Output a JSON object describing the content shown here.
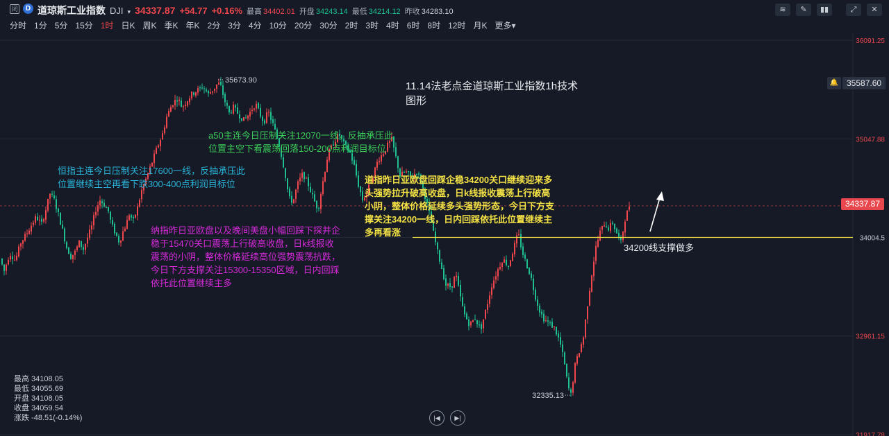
{
  "header": {
    "close_icon": "闭",
    "logo_icon": "D",
    "name": "道琼斯工业指数",
    "code": "DJI",
    "price": "34337.87",
    "change": "+54.77",
    "change_pct": "+0.16%",
    "high_label": "最高",
    "high_value": "34402.01",
    "open_label": "开盘",
    "open_value": "34243.14",
    "low_label": "最低",
    "low_value": "34214.12",
    "prev_label": "昨收",
    "prev_value": "34283.10"
  },
  "tools": [
    "trend-tool-icon",
    "draw-tool-icon",
    "indicator-tool-icon",
    "expand-icon",
    "close-icon"
  ],
  "periods": [
    "分时",
    "1分",
    "5分",
    "15分",
    "1时",
    "日K",
    "周K",
    "季K",
    "年K",
    "2分",
    "3分",
    "4分",
    "10分",
    "20分",
    "30分",
    "2时",
    "3时",
    "4时",
    "6时",
    "8时",
    "12时",
    "月K",
    "更多▾"
  ],
  "active_period": "1时",
  "ohlc_panel": {
    "high": "最高 34108.05",
    "low": "最低 34055.69",
    "open": "开盘 34108.05",
    "close": "收盘 34059.54",
    "change": "涨跌 -48.51(-0.14%)"
  },
  "alert": {
    "icon": "bell-icon",
    "value": "35587.60"
  },
  "current_price_tag": "34337.87",
  "support_line_value": "34004.5",
  "annotations": {
    "title": [
      "11.14法老点金道琼斯工业指数1h技术",
      "图形"
    ],
    "a50": [
      "a50主连今日压制关注12070一线，反抽承压此",
      "位置主空下看震荡回落150-200点利润目标位"
    ],
    "hsi": [
      "恒指主连今日压制关注17600一线，反抽承压此",
      "位置继续主空再看下跌300-400点利润目标位"
    ],
    "dji": [
      "道指昨日亚欧盘回踩企稳34200关口继续迎来多",
      "头强势拉升破高收盘，日k线报收震荡上行破高",
      "小阴，整体价格延续多头强势形态，今日下方支",
      "撑关注34200一线，日内回踩依托此位置继续主",
      "多再看涨"
    ],
    "ndx": [
      "纳指昨日亚欧盘以及晚间美盘小幅回踩下探并企",
      "稳于15470关口震荡上行破高收盘，日k线报收",
      "震荡的小阴，整体价格延续高位强势震荡抗跌，",
      "今日下方支撑关注15300-15350区域，日内回踩",
      "依托此位置继续主多"
    ],
    "support": "34200线支撑做多"
  },
  "chart_data": {
    "type": "candlestick",
    "title": "",
    "y_axis_ticks": [
      "36091.25",
      "35047.88",
      "34004.5",
      "32961.15",
      "31917.78"
    ],
    "ylim": [
      31917.78,
      36091.25
    ],
    "grid": true,
    "high_marker": "35673.90",
    "low_marker": "32335.13",
    "last_price": 34337.87,
    "horizontal_line": 34004.5,
    "colors": {
      "up": "#f0474c",
      "down": "#1fbf8f",
      "support": "#f2e045",
      "background": "#151a26"
    },
    "path": [
      [
        0,
        33780
      ],
      [
        6,
        33650
      ],
      [
        14,
        33840
      ],
      [
        22,
        33760
      ],
      [
        30,
        33950
      ],
      [
        38,
        34040
      ],
      [
        44,
        34120
      ],
      [
        52,
        34220
      ],
      [
        60,
        34150
      ],
      [
        66,
        34300
      ],
      [
        72,
        34470
      ],
      [
        78,
        34400
      ],
      [
        84,
        34250
      ],
      [
        90,
        34080
      ],
      [
        96,
        33900
      ],
      [
        102,
        33800
      ],
      [
        108,
        33850
      ],
      [
        114,
        33950
      ],
      [
        120,
        33880
      ],
      [
        126,
        34000
      ],
      [
        132,
        34120
      ],
      [
        138,
        34300
      ],
      [
        144,
        34400
      ],
      [
        150,
        34350
      ],
      [
        156,
        34280
      ],
      [
        160,
        34150
      ],
      [
        166,
        34050
      ],
      [
        172,
        33950
      ],
      [
        176,
        34050
      ],
      [
        182,
        34150
      ],
      [
        186,
        34250
      ],
      [
        192,
        34180
      ],
      [
        198,
        34320
      ],
      [
        204,
        34500
      ],
      [
        210,
        34620
      ],
      [
        218,
        34780
      ],
      [
        226,
        34950
      ],
      [
        234,
        35100
      ],
      [
        240,
        35280
      ],
      [
        248,
        35420
      ],
      [
        256,
        35480
      ],
      [
        262,
        35380
      ],
      [
        268,
        35440
      ],
      [
        276,
        35520
      ],
      [
        284,
        35560
      ],
      [
        292,
        35600
      ],
      [
        300,
        35520
      ],
      [
        308,
        35580
      ],
      [
        314,
        35640
      ],
      [
        318,
        35600
      ],
      [
        324,
        35440
      ],
      [
        330,
        35320
      ],
      [
        336,
        35380
      ],
      [
        344,
        35300
      ],
      [
        352,
        35240
      ],
      [
        360,
        35330
      ],
      [
        368,
        35420
      ],
      [
        374,
        35310
      ],
      [
        380,
        35220
      ],
      [
        386,
        35340
      ],
      [
        394,
        35180
      ],
      [
        402,
        34980
      ],
      [
        410,
        34700
      ],
      [
        416,
        34420
      ],
      [
        422,
        34380
      ],
      [
        428,
        34560
      ],
      [
        436,
        34680
      ],
      [
        444,
        34560
      ],
      [
        452,
        34400
      ],
      [
        458,
        34300
      ],
      [
        464,
        34560
      ],
      [
        472,
        34880
      ],
      [
        480,
        35000
      ],
      [
        488,
        35100
      ],
      [
        496,
        34980
      ],
      [
        504,
        34900
      ],
      [
        510,
        34760
      ],
      [
        516,
        34560
      ],
      [
        522,
        34400
      ],
      [
        528,
        34480
      ],
      [
        536,
        34640
      ],
      [
        544,
        34820
      ],
      [
        552,
        34900
      ],
      [
        558,
        34980
      ],
      [
        564,
        35040
      ],
      [
        570,
        34850
      ],
      [
        576,
        34660
      ],
      [
        584,
        34700
      ],
      [
        592,
        34640
      ],
      [
        600,
        34700
      ],
      [
        606,
        34600
      ],
      [
        612,
        34440
      ],
      [
        618,
        34260
      ],
      [
        624,
        34050
      ],
      [
        630,
        33850
      ],
      [
        636,
        33680
      ],
      [
        642,
        33500
      ],
      [
        650,
        33480
      ],
      [
        656,
        33620
      ],
      [
        662,
        33400
      ],
      [
        668,
        33200
      ],
      [
        676,
        33080
      ],
      [
        684,
        33150
      ],
      [
        692,
        33030
      ],
      [
        700,
        33250
      ],
      [
        708,
        33500
      ],
      [
        716,
        33650
      ],
      [
        724,
        33780
      ],
      [
        732,
        33700
      ],
      [
        740,
        33900
      ],
      [
        746,
        34050
      ],
      [
        752,
        33850
      ],
      [
        758,
        33720
      ],
      [
        764,
        33600
      ],
      [
        770,
        33400
      ],
      [
        776,
        33250
      ],
      [
        782,
        33150
      ],
      [
        790,
        33100
      ],
      [
        798,
        33050
      ],
      [
        806,
        32900
      ],
      [
        812,
        32700
      ],
      [
        818,
        32420
      ],
      [
        822,
        32340
      ],
      [
        828,
        32650
      ],
      [
        834,
        32800
      ],
      [
        840,
        32950
      ],
      [
        846,
        33300
      ],
      [
        852,
        33620
      ],
      [
        858,
        33900
      ],
      [
        864,
        34060
      ],
      [
        870,
        34150
      ],
      [
        876,
        34100
      ],
      [
        882,
        34160
      ],
      [
        888,
        34050
      ],
      [
        894,
        33950
      ],
      [
        900,
        34200
      ],
      [
        906,
        34340
      ],
      [
        910,
        34337
      ]
    ]
  }
}
